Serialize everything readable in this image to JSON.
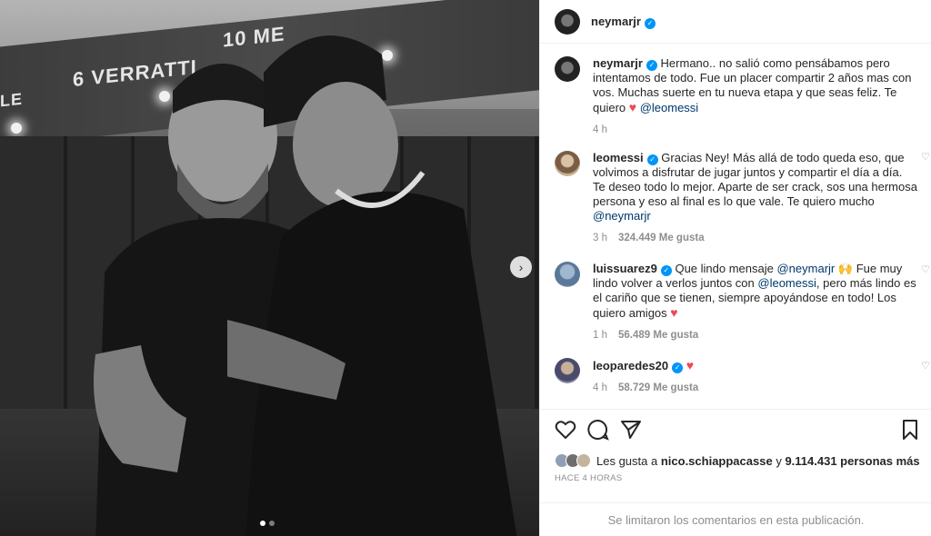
{
  "post": {
    "author": "neymarjr",
    "photo": {
      "banner_texts": [
        "6 VERRATTI",
        "10 ME",
        "LE"
      ]
    }
  },
  "comments": [
    {
      "user": "neymarjr",
      "text_1": "Hermano.. no salió como pensábamos pero intentamos de todo. Fue un placer compartir 2 años mas con vos. Muchas suerte en tu nueva etapa y que seas feliz. Te quiero",
      "mention": "@leomessi",
      "time": "4 h"
    },
    {
      "user": "leomessi",
      "text_1": "Gracias Ney! Más allá de todo queda eso, que volvimos a disfrutar de jugar juntos y compartir el día a día. Te deseo todo lo mejor. Aparte de ser crack, sos una hermosa persona y eso al final es lo que vale. Te quiero mucho",
      "mention": "@neymarjr",
      "time": "3 h",
      "likes": "324.449 Me gusta"
    },
    {
      "user": "luissuarez9",
      "text_1": "Que lindo mensaje",
      "mention_1": "@neymarjr",
      "text_2": "Fue muy lindo volver a verlos juntos con",
      "mention_2": "@leomessi",
      "text_3": ", pero más lindo es el cariño que se tienen, siempre apoyándose en todo! Los quiero amigos",
      "time": "1 h",
      "likes": "56.489 Me gusta"
    },
    {
      "user": "leoparedes20",
      "time": "4 h",
      "likes": "58.729 Me gusta"
    }
  ],
  "liked_by": {
    "prefix": "Les gusta a",
    "user": "nico.schiappacasse",
    "middle": "y",
    "count": "9.114.431 personas más"
  },
  "time_ago": "HACE 4 HORAS",
  "comments_disabled": "Se limitaron los comentarios en esta publicación.",
  "icons": [
    "heart-icon",
    "comment-icon",
    "share-icon",
    "save-icon",
    "chevron-right-icon",
    "verified-icon"
  ],
  "colors": {
    "verified": "#0095f6",
    "heart": "#ed4956",
    "mention": "#00376b",
    "muted": "#8e8e8e"
  }
}
